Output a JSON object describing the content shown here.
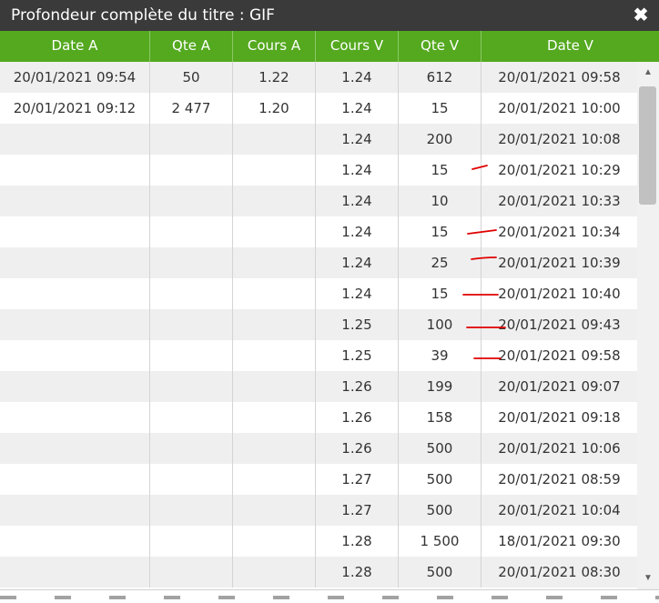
{
  "dialog": {
    "title": "Profondeur complète du titre : GIF",
    "close_icon": "close-icon"
  },
  "table": {
    "columns": [
      "Date A",
      "Qte A",
      "Cours A",
      "Cours V",
      "Qte V",
      "Date V"
    ],
    "rows": [
      [
        "20/01/2021 09:54",
        "50",
        "1.22",
        "1.24",
        "612",
        "20/01/2021 09:58"
      ],
      [
        "20/01/2021 09:12",
        "2 477",
        "1.20",
        "1.24",
        "15",
        "20/01/2021 10:00"
      ],
      [
        "",
        "",
        "",
        "1.24",
        "200",
        "20/01/2021 10:08"
      ],
      [
        "",
        "",
        "",
        "1.24",
        "15",
        "20/01/2021 10:29"
      ],
      [
        "",
        "",
        "",
        "1.24",
        "10",
        "20/01/2021 10:33"
      ],
      [
        "",
        "",
        "",
        "1.24",
        "15",
        "20/01/2021 10:34"
      ],
      [
        "",
        "",
        "",
        "1.24",
        "25",
        "20/01/2021 10:39"
      ],
      [
        "",
        "",
        "",
        "1.24",
        "15",
        "20/01/2021 10:40"
      ],
      [
        "",
        "",
        "",
        "1.25",
        "100",
        "20/01/2021 09:43"
      ],
      [
        "",
        "",
        "",
        "1.25",
        "39",
        "20/01/2021 09:58"
      ],
      [
        "",
        "",
        "",
        "1.26",
        "199",
        "20/01/2021 09:07"
      ],
      [
        "",
        "",
        "",
        "1.26",
        "158",
        "20/01/2021 09:18"
      ],
      [
        "",
        "",
        "",
        "1.26",
        "500",
        "20/01/2021 10:06"
      ],
      [
        "",
        "",
        "",
        "1.27",
        "500",
        "20/01/2021 08:59"
      ],
      [
        "",
        "",
        "",
        "1.27",
        "500",
        "20/01/2021 10:04"
      ],
      [
        "",
        "",
        "",
        "1.28",
        "1 500",
        "18/01/2021 09:30"
      ],
      [
        "",
        "",
        "",
        "1.28",
        "500",
        "20/01/2021 08:30"
      ]
    ]
  },
  "annotations": {
    "color": "#e00000",
    "marked_rows": [
      1,
      3,
      4,
      5,
      6,
      7
    ]
  },
  "colors": {
    "titlebar": "#3a3a3a",
    "header": "#54a91f",
    "row_alt": "#efefef"
  }
}
